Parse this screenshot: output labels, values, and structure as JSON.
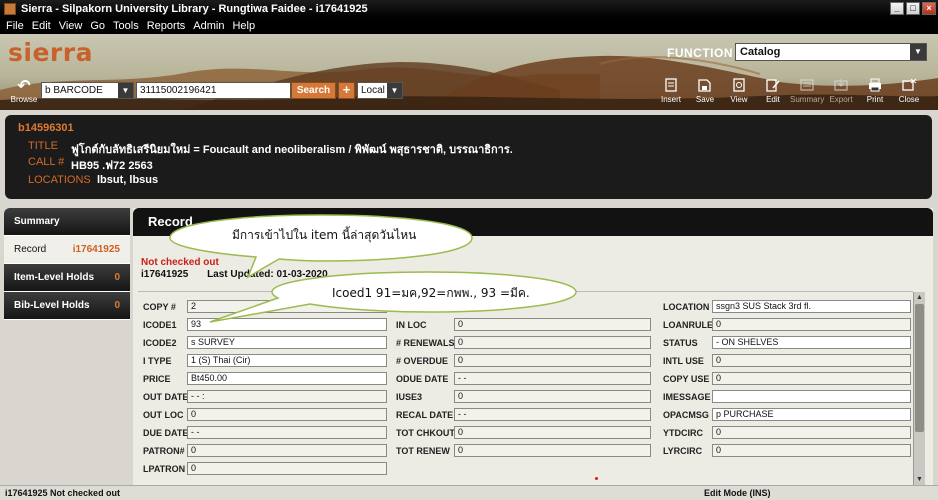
{
  "window": {
    "title": "Sierra - Silpakorn University Library - Rungtiwa Faidee - i17641925"
  },
  "menu": [
    "File",
    "Edit",
    "View",
    "Go",
    "Tools",
    "Reports",
    "Admin",
    "Help"
  ],
  "banner": {
    "logo": "sierra",
    "function_label": "FUNCTION",
    "function_value": "Catalog"
  },
  "searchbar": {
    "browse_label": "Browse",
    "index": "b BARCODE",
    "query": "31115002196421",
    "search_label": "Search",
    "plus_label": "+",
    "scope": "Local"
  },
  "toolbar": [
    {
      "label": "Insert",
      "icon": "insert-icon",
      "enabled": true
    },
    {
      "label": "Save",
      "icon": "save-icon",
      "enabled": true
    },
    {
      "label": "View",
      "icon": "view-icon",
      "enabled": true
    },
    {
      "label": "Edit",
      "icon": "edit-icon",
      "enabled": true
    },
    {
      "label": "Summary",
      "icon": "summary-icon",
      "enabled": false
    },
    {
      "label": "Export",
      "icon": "export-icon",
      "enabled": false
    },
    {
      "label": "Print",
      "icon": "print-icon",
      "enabled": true
    },
    {
      "label": "Close",
      "icon": "close-icon",
      "enabled": true
    }
  ],
  "record_header": {
    "record_id": "b14596301",
    "title_label": "TITLE",
    "title_value": "ฟูโกต์กับลัทธิเสรีนิยมใหม่ = Foucault and neoliberalism / พิพัฒน์ พสุธารชาติ, บรรณาธิการ.",
    "call_label": "CALL #",
    "call_value": "HB95 .ฟ72 2563",
    "locations_label": "LOCATIONS",
    "locations_value": "lbsut, lbsus"
  },
  "nav": [
    {
      "label": "Summary",
      "count": ""
    },
    {
      "label": "Record",
      "count": "i17641925"
    },
    {
      "label": "Item-Level Holds",
      "count": "0"
    },
    {
      "label": "Bib-Level Holds",
      "count": "0"
    }
  ],
  "main": {
    "header": "Record",
    "status": "Not checked out",
    "item_id": "i17641925",
    "last_updated": "Last Updated: 01-03-2020"
  },
  "fields": {
    "col1": [
      {
        "label": "COPY #",
        "value": "2"
      },
      {
        "label": "ICODE1",
        "value": "93"
      },
      {
        "label": "ICODE2",
        "value": "s  SURVEY"
      },
      {
        "label": "I TYPE",
        "value": "1  (S) Thai (Cir)"
      },
      {
        "label": "PRICE",
        "value": "Bt450.00"
      },
      {
        "label": "OUT DATE",
        "value": "- -      :"
      },
      {
        "label": "OUT LOC",
        "value": "0"
      },
      {
        "label": "DUE DATE",
        "value": "- -"
      },
      {
        "label": "PATRON#",
        "value": "0"
      },
      {
        "label": "LPATRON",
        "value": "0"
      }
    ],
    "col2": [
      {
        "label": "IN LOC",
        "value": "0"
      },
      {
        "label": "# RENEWALS",
        "value": "0"
      },
      {
        "label": "# OVERDUE",
        "value": "0"
      },
      {
        "label": "ODUE DATE",
        "value": "- -"
      },
      {
        "label": "IUSE3",
        "value": "0"
      },
      {
        "label": "RECAL DATE",
        "value": "- -"
      },
      {
        "label": "TOT CHKOUT",
        "value": "0"
      },
      {
        "label": "TOT RENEW",
        "value": "0"
      }
    ],
    "col3": [
      {
        "label": "LOCATION",
        "value": "ssgn3  SUS Stack 3rd fl."
      },
      {
        "label": "LOANRULE",
        "value": "0"
      },
      {
        "label": "STATUS",
        "value": "-  ON SHELVES"
      },
      {
        "label": "INTL USE",
        "value": "0"
      },
      {
        "label": "COPY USE",
        "value": "0"
      },
      {
        "label": "IMESSAGE",
        "value": ""
      },
      {
        "label": "OPACMSG",
        "value": "p  PURCHASE"
      },
      {
        "label": "YTDCIRC",
        "value": "0"
      },
      {
        "label": "LYRCIRC",
        "value": "0"
      }
    ]
  },
  "callouts": {
    "top": "มีการเข้าไปใน item นี้ล่าสุดวันไหน",
    "bottom": "Icoed1 91=มค,92=กพพ., 93 =มีค."
  },
  "statusbar": {
    "left": "i17641925  Not checked out",
    "right": "Edit Mode (INS)"
  }
}
